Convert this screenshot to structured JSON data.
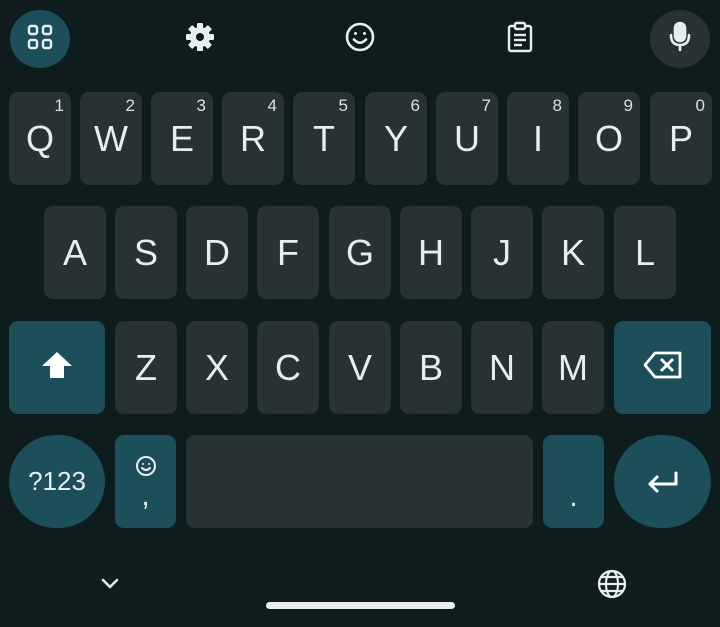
{
  "toolbar": {
    "icons": [
      "apps-grid-icon",
      "gear-icon",
      "emoji-icon",
      "clipboard-icon",
      "microphone-icon"
    ]
  },
  "rows": {
    "row1": [
      {
        "letter": "Q",
        "hint": "1"
      },
      {
        "letter": "W",
        "hint": "2"
      },
      {
        "letter": "E",
        "hint": "3"
      },
      {
        "letter": "R",
        "hint": "4"
      },
      {
        "letter": "T",
        "hint": "5"
      },
      {
        "letter": "Y",
        "hint": "6"
      },
      {
        "letter": "U",
        "hint": "7"
      },
      {
        "letter": "I",
        "hint": "8"
      },
      {
        "letter": "O",
        "hint": "9"
      },
      {
        "letter": "P",
        "hint": "0"
      }
    ],
    "row2": [
      {
        "letter": "A"
      },
      {
        "letter": "S"
      },
      {
        "letter": "D"
      },
      {
        "letter": "F"
      },
      {
        "letter": "G"
      },
      {
        "letter": "H"
      },
      {
        "letter": "J"
      },
      {
        "letter": "K"
      },
      {
        "letter": "L"
      }
    ],
    "row3": [
      {
        "letter": "Z"
      },
      {
        "letter": "X"
      },
      {
        "letter": "C"
      },
      {
        "letter": "V"
      },
      {
        "letter": "B"
      },
      {
        "letter": "N"
      },
      {
        "letter": "M"
      }
    ]
  },
  "bottom_row": {
    "symbols_label": "?123",
    "comma_label": ",",
    "period_label": "."
  },
  "colors": {
    "background": "#0f1c1d",
    "key": "#273233",
    "accent_key": "#1d4f5a",
    "text": "#e6eeee"
  }
}
